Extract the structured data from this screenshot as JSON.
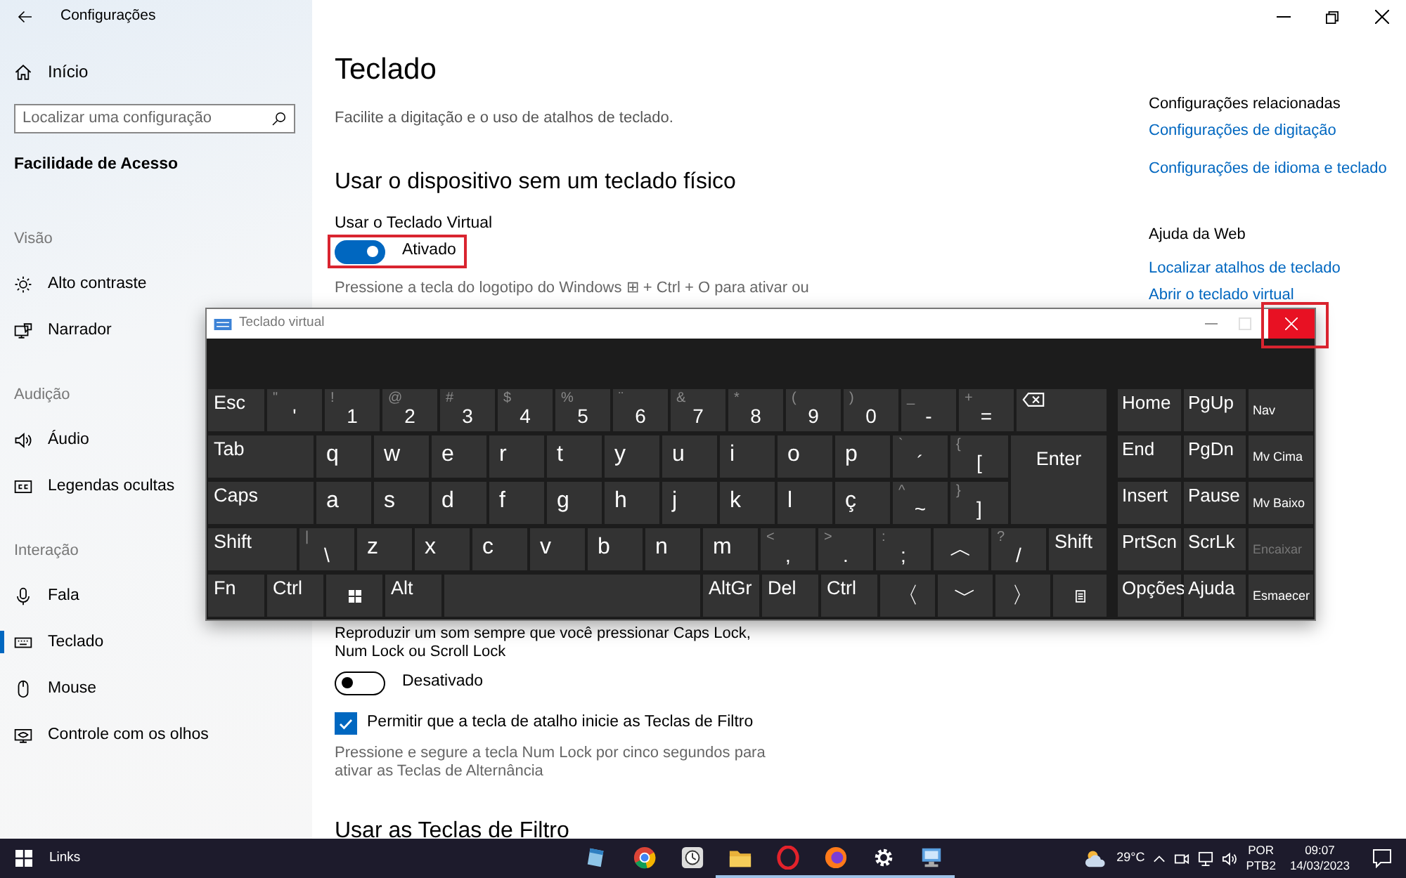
{
  "window": {
    "title": "Configurações"
  },
  "sidebar": {
    "home": "Início",
    "search": {
      "placeholder": "Localizar uma configuração"
    },
    "category": "Facilidade de Acesso",
    "sections": [
      {
        "heading": "Visão",
        "items": [
          {
            "label": "Alto contraste",
            "selected": false
          },
          {
            "label": "Narrador",
            "selected": false
          }
        ]
      },
      {
        "heading": "Audição",
        "items": [
          {
            "label": "Áudio",
            "selected": false
          },
          {
            "label": "Legendas ocultas",
            "selected": false
          }
        ]
      },
      {
        "heading": "Interação",
        "items": [
          {
            "label": "Fala",
            "selected": false
          },
          {
            "label": "Teclado",
            "selected": true
          },
          {
            "label": "Mouse",
            "selected": false
          },
          {
            "label": "Controle com os olhos",
            "selected": false
          }
        ]
      }
    ]
  },
  "main": {
    "title": "Teclado",
    "description": "Facilite a digitação e o uso de atalhos de teclado.",
    "section_heading": "Usar o dispositivo sem um teclado físico",
    "virtual_keyboard": {
      "label": "Usar o Teclado Virtual",
      "toggle": {
        "on": true,
        "text": "Ativado",
        "highlighted": true
      },
      "hint": "Pressione a tecla do logotipo do Windows ⊞ + Ctrl + O para ativar ou"
    },
    "toggle_sound": {
      "label": "Reproduzir um som sempre que você pressionar Caps Lock, Num Lock ou Scroll Lock",
      "toggle": {
        "on": false,
        "text": "Desativado",
        "highlighted": false
      }
    },
    "shortcut": {
      "label": "Permitir que a tecla de atalho inicie as Teclas de Filtro",
      "checked": true,
      "hint": "Pressione e segure a tecla Num Lock por cinco segundos para ativar as Teclas de Alternância"
    },
    "next_heading": "Usar as Teclas de Filtro"
  },
  "related": {
    "heading": "Configurações relacionadas",
    "links": [
      "Configurações de digitação",
      "Configurações de idioma e teclado"
    ]
  },
  "web_help": {
    "heading": "Ajuda da Web",
    "links": [
      "Localizar atalhos de teclado",
      "Abrir o teclado virtual"
    ]
  },
  "virtual_keyboard_window": {
    "title": "Teclado virtual",
    "close_highlighted": true,
    "main_rows": [
      [
        {
          "kind": "text",
          "label": "Esc"
        },
        {
          "kind": "dual",
          "shift": "\"",
          "label": "'"
        },
        {
          "kind": "dual",
          "shift": "!",
          "label": "1"
        },
        {
          "kind": "dual",
          "shift": "@",
          "label": "2"
        },
        {
          "kind": "dual",
          "shift": "#",
          "label": "3"
        },
        {
          "kind": "dual",
          "shift": "$",
          "label": "4"
        },
        {
          "kind": "dual",
          "shift": "%",
          "label": "5"
        },
        {
          "kind": "dual",
          "shift": "¨",
          "label": "6"
        },
        {
          "kind": "dual",
          "shift": "&",
          "label": "7"
        },
        {
          "kind": "dual",
          "shift": "*",
          "label": "8"
        },
        {
          "kind": "dual",
          "shift": "(",
          "label": "9"
        },
        {
          "kind": "dual",
          "shift": ")",
          "label": "0"
        },
        {
          "kind": "dual",
          "shift": "_",
          "label": "-"
        },
        {
          "kind": "dual",
          "shift": "+",
          "label": "="
        },
        {
          "kind": "backspace"
        }
      ],
      [
        {
          "kind": "text",
          "label": "Tab"
        },
        {
          "kind": "text",
          "label": "q"
        },
        {
          "kind": "text",
          "label": "w"
        },
        {
          "kind": "text",
          "label": "e"
        },
        {
          "kind": "text",
          "label": "r"
        },
        {
          "kind": "text",
          "label": "t"
        },
        {
          "kind": "text",
          "label": "y"
        },
        {
          "kind": "text",
          "label": "u"
        },
        {
          "kind": "text",
          "label": "i"
        },
        {
          "kind": "text",
          "label": "o"
        },
        {
          "kind": "text",
          "label": "p"
        },
        {
          "kind": "dual",
          "shift": "`",
          "label": "´"
        },
        {
          "kind": "dual",
          "shift": "{",
          "label": "["
        },
        {
          "kind": "tall",
          "label": "Enter"
        }
      ],
      [
        {
          "kind": "text",
          "label": "Caps"
        },
        {
          "kind": "text",
          "label": "a"
        },
        {
          "kind": "text",
          "label": "s"
        },
        {
          "kind": "text",
          "label": "d"
        },
        {
          "kind": "text",
          "label": "f"
        },
        {
          "kind": "text",
          "label": "g"
        },
        {
          "kind": "text",
          "label": "h"
        },
        {
          "kind": "text",
          "label": "j"
        },
        {
          "kind": "text",
          "label": "k"
        },
        {
          "kind": "text",
          "label": "l"
        },
        {
          "kind": "text",
          "label": "ç"
        },
        {
          "kind": "dual",
          "shift": "^",
          "label": "~"
        },
        {
          "kind": "dual",
          "shift": "}",
          "label": "]"
        }
      ],
      [
        {
          "kind": "text",
          "label": "Shift"
        },
        {
          "kind": "dual",
          "shift": "|",
          "label": "\\"
        },
        {
          "kind": "text",
          "label": "z"
        },
        {
          "kind": "text",
          "label": "x"
        },
        {
          "kind": "text",
          "label": "c"
        },
        {
          "kind": "text",
          "label": "v"
        },
        {
          "kind": "text",
          "label": "b"
        },
        {
          "kind": "text",
          "label": "n"
        },
        {
          "kind": "text",
          "label": "m"
        },
        {
          "kind": "dual",
          "shift": "<",
          "label": ","
        },
        {
          "kind": "dual",
          "shift": ">",
          "label": "."
        },
        {
          "kind": "dual",
          "shift": ":",
          "label": ";"
        },
        {
          "kind": "arrow",
          "label": "︿"
        },
        {
          "kind": "dual",
          "shift": "?",
          "label": "/"
        },
        {
          "kind": "text",
          "label": "Shift"
        }
      ],
      [
        {
          "kind": "text",
          "label": "Fn"
        },
        {
          "kind": "text",
          "label": "Ctrl"
        },
        {
          "kind": "windows"
        },
        {
          "kind": "text",
          "label": "Alt"
        },
        {
          "kind": "space"
        },
        {
          "kind": "text",
          "label": "AltGr"
        },
        {
          "kind": "text",
          "label": "Del"
        },
        {
          "kind": "text",
          "label": "Ctrl"
        },
        {
          "kind": "arrow",
          "label": "〈"
        },
        {
          "kind": "arrow",
          "label": "﹀"
        },
        {
          "kind": "arrow",
          "label": "〉"
        },
        {
          "kind": "menu"
        }
      ]
    ],
    "side_rows": [
      [
        {
          "label": "Home",
          "disabled": false
        },
        {
          "label": "PgUp",
          "disabled": false
        },
        {
          "label": "Nav",
          "disabled": false
        }
      ],
      [
        {
          "label": "End",
          "disabled": false
        },
        {
          "label": "PgDn",
          "disabled": false
        },
        {
          "label": "Mv Cima",
          "disabled": false
        }
      ],
      [
        {
          "label": "Insert",
          "disabled": false
        },
        {
          "label": "Pause",
          "disabled": false
        },
        {
          "label": "Mv Baixo",
          "disabled": false
        }
      ],
      [
        {
          "label": "PrtScn",
          "disabled": false
        },
        {
          "label": "ScrLk",
          "disabled": false
        },
        {
          "label": "Encaixar",
          "disabled": true
        }
      ],
      [
        {
          "label": "Opções",
          "disabled": false
        },
        {
          "label": "Ajuda",
          "disabled": false
        },
        {
          "label": "Esmaecer",
          "disabled": false
        }
      ]
    ]
  },
  "taskbar": {
    "start_label": "Links",
    "apps": [
      {
        "running": false
      },
      {
        "running": false
      },
      {
        "running": false
      },
      {
        "running": true
      },
      {
        "running": true
      },
      {
        "running": true
      },
      {
        "running": true
      },
      {
        "running": true
      }
    ],
    "weather": "29°C",
    "language": "POR",
    "layout": "PTB2",
    "time": "09:07",
    "date": "14/03/2023"
  }
}
